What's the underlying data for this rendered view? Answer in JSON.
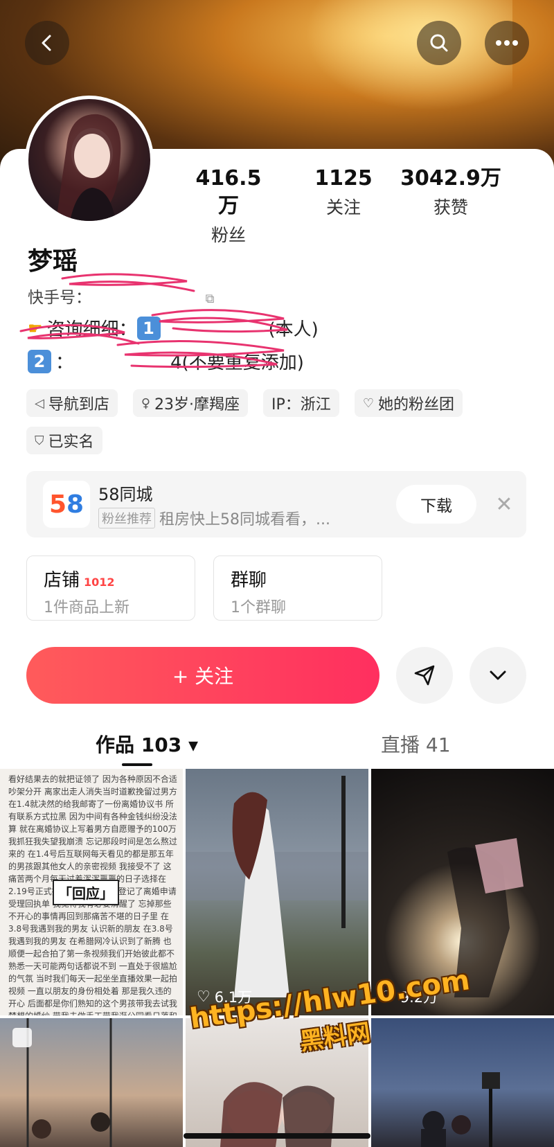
{
  "profile": {
    "name": "梦瑶",
    "kuaishou_id_label": "快手号：",
    "bio_line1_prefix": "咨询细细：",
    "bio_line1_key": "1",
    "bio_line1_suffix": "(本人)",
    "bio_line2_key": "2",
    "bio_line2_text": "：",
    "bio_line2_suffix": "4(不要重复添加)"
  },
  "stats": [
    {
      "value": "416.5万",
      "label": "粉丝"
    },
    {
      "value": "1125",
      "label": "关注"
    },
    {
      "value": "3042.9万",
      "label": "获赞"
    }
  ],
  "tags": [
    {
      "icon": "navigation-icon",
      "glyph": "◁",
      "label": "导航到店"
    },
    {
      "icon": "gender-icon",
      "glyph": "♀",
      "label": "23岁·摩羯座"
    },
    {
      "icon": "",
      "glyph": "",
      "label": "IP：浙江"
    },
    {
      "icon": "heart-icon",
      "glyph": "♡",
      "label": "她的粉丝团"
    },
    {
      "icon": "verified-icon",
      "glyph": "⛉",
      "label": "已实名"
    }
  ],
  "ad": {
    "logo_text_5": "5",
    "logo_text_8": "8",
    "title": "58同城",
    "badge": "粉丝推荐",
    "desc": "租房快上58同城看看，...",
    "download_label": "下载",
    "close_glyph": "✕"
  },
  "shop": {
    "title": "店铺",
    "badge": "1012",
    "sub": "1件商品上新"
  },
  "group_chat": {
    "title": "群聊",
    "sub": "1个群聊"
  },
  "follow_label": "+ 关注",
  "tabs": {
    "works": "作品 103 ▾",
    "live": "直播 41"
  },
  "grid": {
    "post1_text": "看好结果去的就把证领了 因为各种原因不合适吵架分开 离家出走人消失当时道歉挽留过男方在1.4就决然的给我邮寄了一份离婚协议书 所有联系方式拉黑 因为中间有各种金钱纠纷没法算 就在离婚协议上写着男方自愿赠予的100万 我抓狂我失望我崩溃 忘记那段时间是怎么熬过来的 在1.4号后互联网每天看见的都是那五年的男孩跟其他女人的亲密视频 我接受不了 这痛苦两个月每天过着浑浑噩噩的日子选择在2.19号正式接受了这个选择去登记了离婚申请受理回执单 我觉得我有必要清醒了 忘掉那些不开心的事情再回到那痛苦不堪的日子里 在3.8号我遇到我的男友 认识新的朋友 在3.8号我遇到我的男友 在希腊网冷认识到了新腾 也顺便一起合拍了第一条视频我们开始彼此都不熟悉一天可能两句话都说不到 一直处于很尴尬的气氛 当时我们每天一起坐坐直播效果一起拍视频 一直以朋友的身份相处着 那是我久违的开心 后面都是你们熟知的这个男孩带我去试我梦想的婚纱 带我去做手工带我逛公园看日落和每天一束小鲜花带我去做好多我以前觉得很平凡的小事 觉得我照暗的世界亮起来了 好感肯定是有的 他对我的关心和好大",
    "post1_stamp": "「回应」",
    "post2_likes": "6.1万",
    "post3_likes": "9.2万"
  },
  "watermark": {
    "url": "https://hlw10.com",
    "name": "黑料网"
  },
  "colors": {
    "accent": "#ff3b5c",
    "brand_58_orange": "#ff552e",
    "brand_58_blue": "#2f7de1"
  }
}
